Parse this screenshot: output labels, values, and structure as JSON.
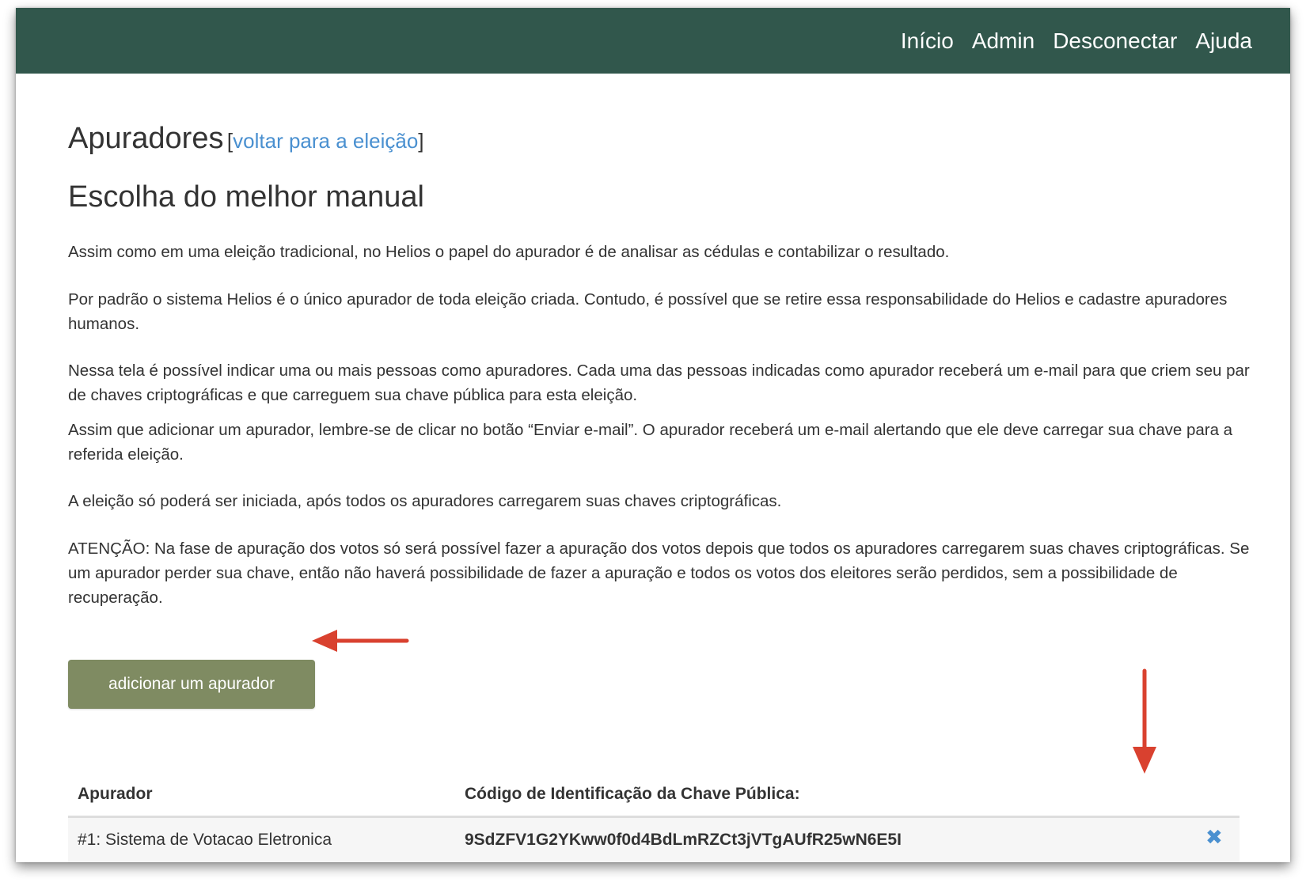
{
  "navbar": {
    "links": [
      "Início",
      "Admin",
      "Desconectar",
      "Ajuda"
    ],
    "background_color": "#31574c"
  },
  "page": {
    "title": "Apuradores",
    "bracket_open": "[",
    "back_link": "voltar para a eleição",
    "bracket_close": "]",
    "election_name": "Escolha do melhor manual"
  },
  "paragraphs": [
    "Assim como em uma eleição tradicional, no Helios o papel do apurador é de analisar as cédulas e contabilizar o resultado.",
    "Por padrão o sistema Helios é o único apurador de toda eleição criada. Contudo, é possível que se retire essa responsabilidade do Helios e cadastre apuradores humanos.",
    "Nessa tela é possível indicar uma ou mais pessoas como apuradores. Cada uma das pessoas indicadas como apurador receberá um e-mail para que criem seu par de chaves criptográficas e que carreguem sua chave pública para esta eleição.",
    "Assim que adicionar um apurador, lembre-se de clicar no botão “Enviar e-mail”. O apurador receberá um e-mail alertando que ele deve carregar sua chave para a referida eleição.",
    "A eleição só poderá ser iniciada, após todos os apuradores carregarem suas chaves criptográficas.",
    "ATENÇÃO: Na fase de apuração dos votos só será possível fazer a apuração dos votos depois que todos os apuradores carregarem suas chaves criptográficas. Se um apurador perder sua chave, então não haverá possibilidade de fazer a apuração e todos os votos dos eleitores serão perdidos, sem a possibilidade de recuperação."
  ],
  "add_button": {
    "label": "adicionar um apurador",
    "color": "#7f8b62"
  },
  "table": {
    "headers": [
      "Apurador",
      "Código de Identificação da Chave Pública:"
    ],
    "rows": [
      {
        "apurador": "#1: Sistema de Votacao Eletronica",
        "code": "9SdZFV1G2YKww0f0d4BdLmRZCt3jVTgAUfR25wN6E5I",
        "remove_icon": "✖"
      }
    ]
  },
  "annotation_color": "#d9412f",
  "link_color": "#4a90d0"
}
